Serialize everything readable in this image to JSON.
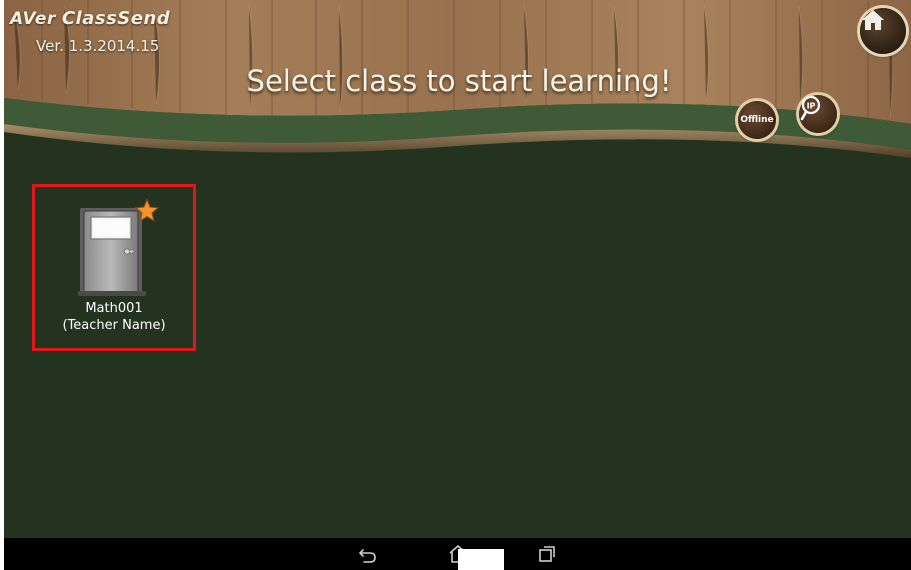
{
  "header": {
    "brand": "AVer",
    "app_name": "ClassSend",
    "version": "Ver. 1.3.2014.15",
    "headline": "Select class to start learning!"
  },
  "buttons": {
    "home_icon": "home-icon",
    "offline_label": "Offline",
    "ip_label": "IP"
  },
  "classes": [
    {
      "name": "Math001",
      "teacher": "(Teacher Name)",
      "favorite": true,
      "icon": "door-icon"
    }
  ],
  "navbar": {
    "icons": [
      "back-icon",
      "home-icon",
      "recent-apps-icon"
    ]
  },
  "colors": {
    "board": "#24331f",
    "wood": "#9a7450",
    "selection": "#e0171b",
    "star": "#f0962a"
  }
}
